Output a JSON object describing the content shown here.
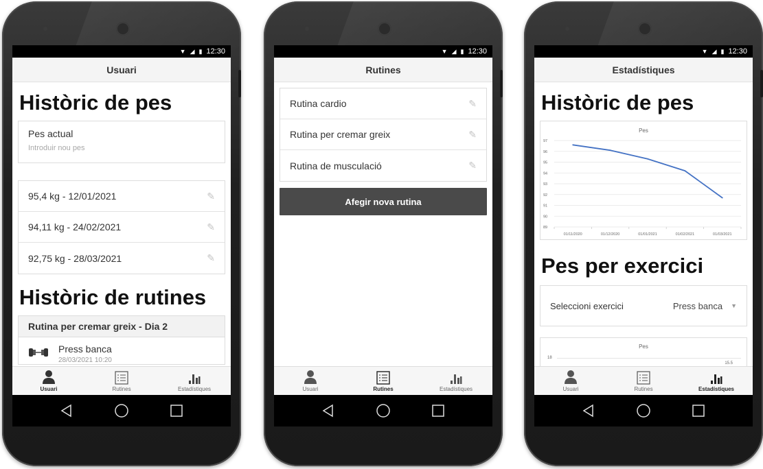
{
  "status": {
    "time": "12:30"
  },
  "tabs": {
    "usuari": "Usuari",
    "rutines": "Rutines",
    "estadistiques": "Estadístiques"
  },
  "screen1": {
    "title": "Usuari",
    "weight_heading": "Històric de pes",
    "weight_input": {
      "label": "Pes actual",
      "placeholder": "Introduir nou pes"
    },
    "weights": [
      "95,4 kg - 12/01/2021",
      "94,11 kg - 24/02/2021",
      "92,75 kg - 28/03/2021"
    ],
    "routines_heading": "Històric de rutines",
    "routine_title": "Rutina per cremar greix - Dia 2",
    "exercise_name": "Press banca",
    "exercise_date": "28/03/2021 10:20"
  },
  "screen2": {
    "title": "Rutines",
    "routines": [
      "Rutina cardio",
      "Rutina per cremar greix",
      "Rutina de musculació"
    ],
    "add_button": "Afegir nova rutina"
  },
  "screen3": {
    "title": "Estadístiques",
    "weight_heading": "Històric de pes",
    "exercise_heading": "Pes per exercici",
    "select_label": "Seleccioni exercici",
    "select_value": "Press banca",
    "chart2_title": "Pes",
    "chart2_y_top": "18",
    "chart2_label": "15.5"
  },
  "chart_data": {
    "type": "line",
    "title": "Pes",
    "x": [
      "01/11/2020",
      "01/12/2020",
      "01/01/2021",
      "01/02/2021",
      "01/03/2021"
    ],
    "series": [
      {
        "values": [
          96.6,
          96.1,
          95.3,
          94.2,
          91.7
        ]
      }
    ],
    "ylim": [
      89,
      97
    ],
    "yticks": [
      "97",
      "96",
      "95",
      "94",
      "93",
      "92",
      "91",
      "90",
      "89"
    ],
    "line_color": "#4472c4",
    "grid": true
  },
  "colors": {
    "button_bg": "#4a4a4a",
    "accent_line": "#4472c4"
  }
}
